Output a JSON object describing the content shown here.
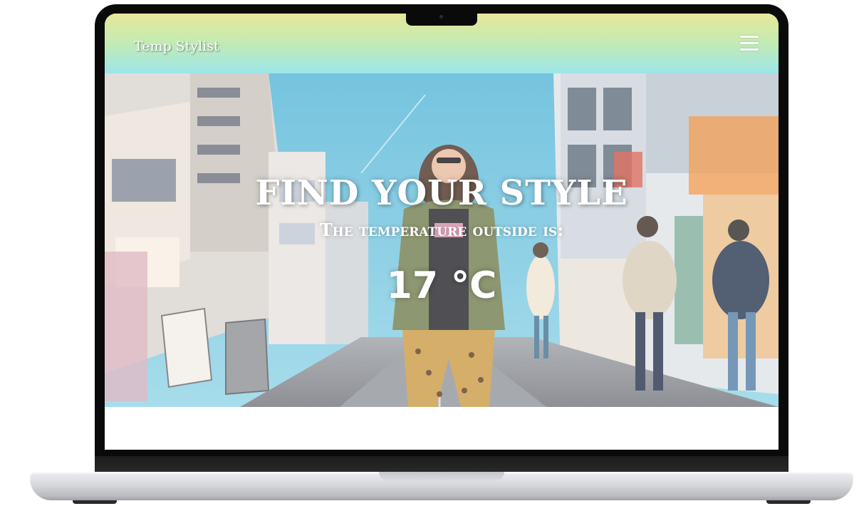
{
  "navbar": {
    "brand": "Temp Stylist",
    "menu_icon": "hamburger-menu-icon"
  },
  "hero": {
    "headline": "FIND YOUR STYLE",
    "subheadline": "The temperature outside is:",
    "temperature": "17 °C"
  },
  "colors": {
    "nav_gradient_top": "#e8e79a",
    "nav_gradient_bottom": "#9ce6ea",
    "text": "#ffffff"
  }
}
